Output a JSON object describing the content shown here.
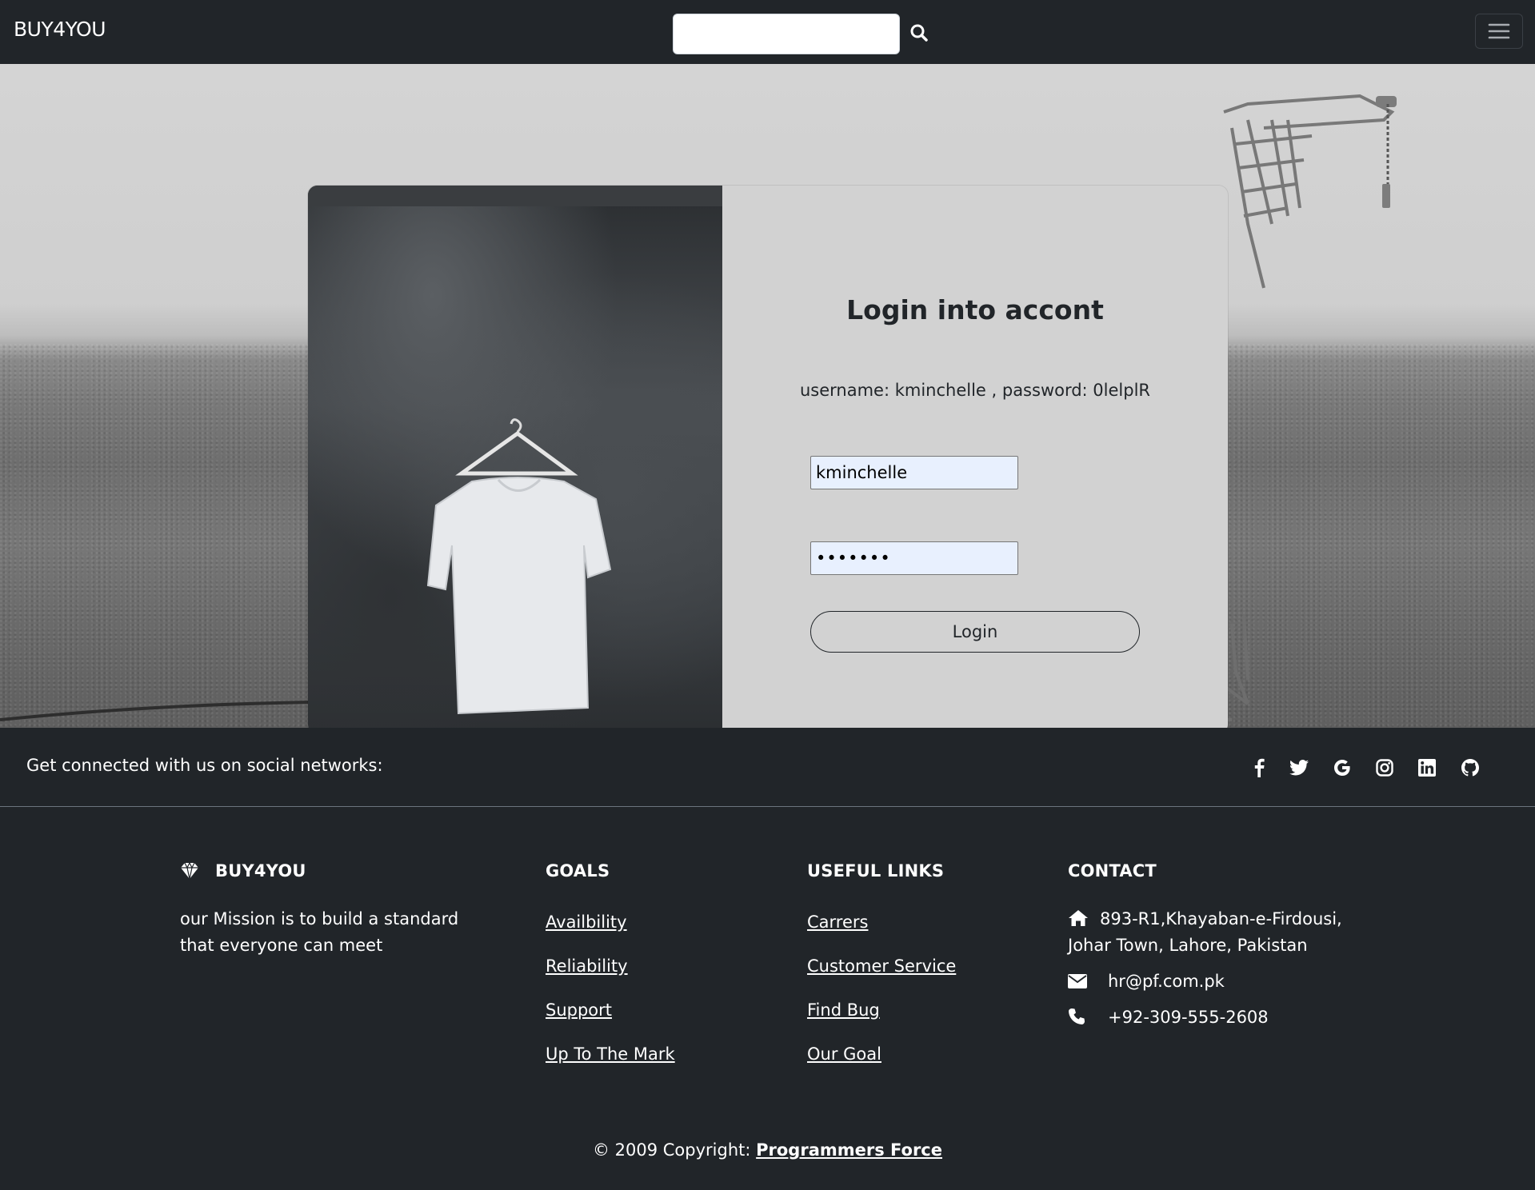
{
  "navbar": {
    "brand": "BUY4YOU",
    "search_placeholder": "",
    "search_icon": "search-icon",
    "menu_icon": "hamburger-menu-icon"
  },
  "login": {
    "title": "Login into accont",
    "credentials_hint": "username: kminchelle , password: 0lelplR",
    "username_value": "kminchelle",
    "password_value": "•••••••",
    "button_label": "Login"
  },
  "social": {
    "text": "Get connected with us on social networks:",
    "icons": [
      "facebook-icon",
      "twitter-icon",
      "google-icon",
      "instagram-icon",
      "linkedin-icon",
      "github-icon"
    ]
  },
  "footer": {
    "brand": {
      "title": "BUY4YOU",
      "icon": "gem-icon",
      "mission_line1": "our Mission is to build a standard",
      "mission_line2": "that everyone can meet"
    },
    "goals": {
      "title": "GOALS",
      "links": [
        "Availbility",
        "Reliability",
        "Support",
        "Up To The Mark"
      ]
    },
    "useful_links": {
      "title": "USEFUL LINKS",
      "links": [
        "Carrers",
        "Customer Service",
        "Find Bug",
        "Our Goal"
      ]
    },
    "contact": {
      "title": "CONTACT",
      "address_line1": "893-R1,Khayaban-e-Firdousi,",
      "address_line2": "Johar Town, Lahore, Pakistan",
      "email": "hr@pf.com.pk",
      "phone": "+92-309-555-2608"
    },
    "copyright_prefix": "© 2009 Copyright: ",
    "copyright_link": "Programmers Force"
  },
  "colors": {
    "navbar_bg": "#212529",
    "card_bg": "#d2d2d2",
    "input_bg": "#e8f0fe"
  }
}
